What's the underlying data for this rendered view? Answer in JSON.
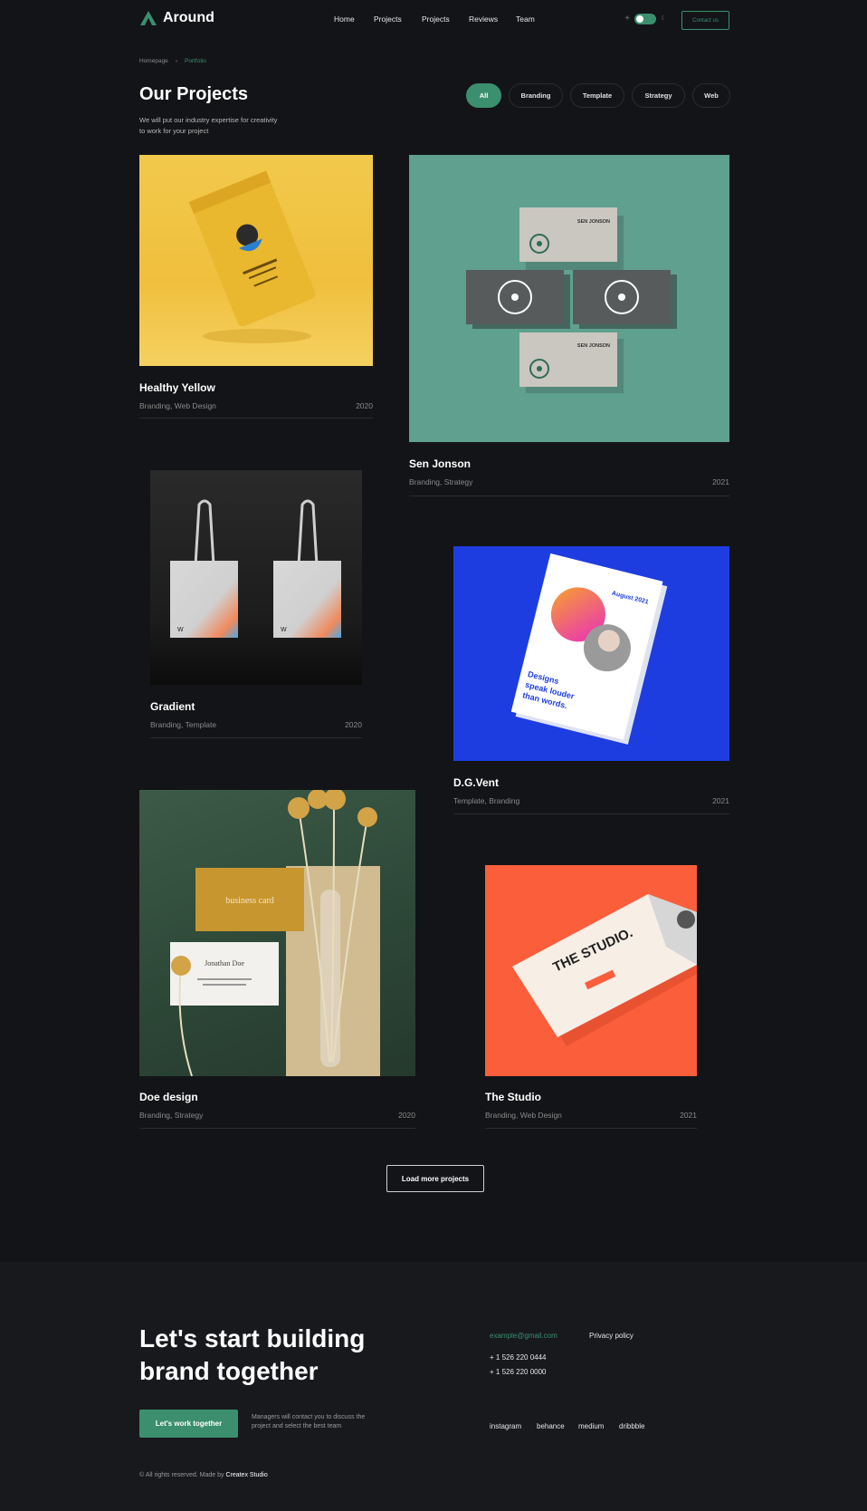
{
  "header": {
    "brand": "Around",
    "nav": [
      "Home",
      "Projects",
      "Projects",
      "Reviews",
      "Team"
    ],
    "contact_label": "Contact us"
  },
  "breadcrumb": {
    "home": "Homepage",
    "current": "Portfolio"
  },
  "page": {
    "title": "Our Projects",
    "subtitle": "We will put our industry expertise for creativity to work for your project"
  },
  "filters": [
    "All",
    "Branding",
    "Template",
    "Strategy",
    "Web"
  ],
  "projects": [
    {
      "title": "Healthy Yellow",
      "tags": "Branding, Web Design",
      "year": "2020"
    },
    {
      "title": "Sen Jonson",
      "tags": "Branding, Strategy",
      "year": "2021"
    },
    {
      "title": "Gradient",
      "tags": "Branding, Template",
      "year": "2020"
    },
    {
      "title": "D.G.Vent",
      "tags": "Template, Branding",
      "year": "2021"
    },
    {
      "title": "Doe design",
      "tags": "Branding, Strategy",
      "year": "2020"
    },
    {
      "title": "The Studio",
      "tags": "Branding, Web Design",
      "year": "2021"
    }
  ],
  "image_text": {
    "card_name": "SEN JONSON",
    "poster_date": "August 2021",
    "poster_slogan": "Designs speak louder than words.",
    "business_card": "business card",
    "doe_name": "Jonathan Doe",
    "studio": "THE STUDIO."
  },
  "load_more": "Load more projects",
  "footer": {
    "heading": "Let's start building brand together",
    "cta": "Let's work together",
    "note": "Managers will contact you to discuss the project and select the best team",
    "email": "example@gmail.com",
    "privacy": "Privacy policy",
    "phones": [
      "+ 1 526 220 0444",
      "+ 1 526 220 0000"
    ],
    "social": [
      "instagram",
      "behance",
      "medium",
      "dribbble"
    ],
    "copyright_prefix": "© All rights reserved. Made by",
    "copyright_brand": "Createx Studio"
  },
  "colors": {
    "background": "#131417",
    "footer_background": "#18191d",
    "accent": "#3b8f6e"
  }
}
